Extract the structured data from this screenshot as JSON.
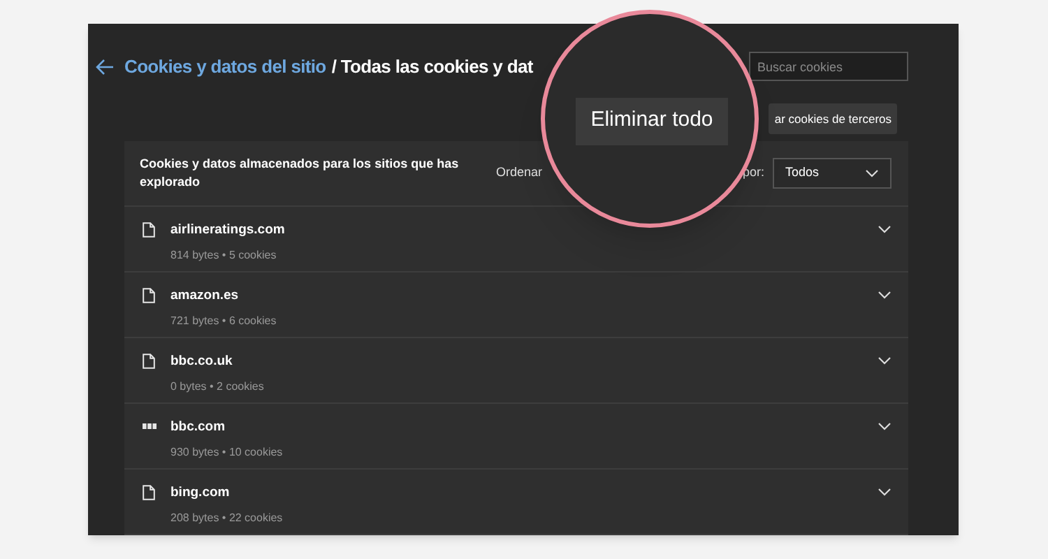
{
  "header": {
    "breadcrumb_link": "Cookies y datos del sitio",
    "breadcrumb_current": "/ Todas las cookies y dat",
    "search": {
      "placeholder": "Buscar cookies"
    }
  },
  "third_party_button": "ar cookies de terceros",
  "magnifier": {
    "button": "Eliminar todo"
  },
  "list_header": {
    "description": "Cookies y datos almacenados para los sitios que has explorado",
    "sort_label_left": "Ordenar",
    "sort_label_right": "por:",
    "filter": "Todos"
  },
  "sites": [
    {
      "name": "airlineratings.com",
      "details": "814 bytes • 5 cookies",
      "kind": "file"
    },
    {
      "name": "amazon.es",
      "details": "721 bytes • 6 cookies",
      "kind": "file"
    },
    {
      "name": "bbc.co.uk",
      "details": "0 bytes • 2 cookies",
      "kind": "file"
    },
    {
      "name": "bbc.com",
      "details": "930 bytes • 10 cookies",
      "kind": "logo"
    },
    {
      "name": "bing.com",
      "details": "208 bytes • 22 cookies",
      "kind": "file"
    }
  ]
}
